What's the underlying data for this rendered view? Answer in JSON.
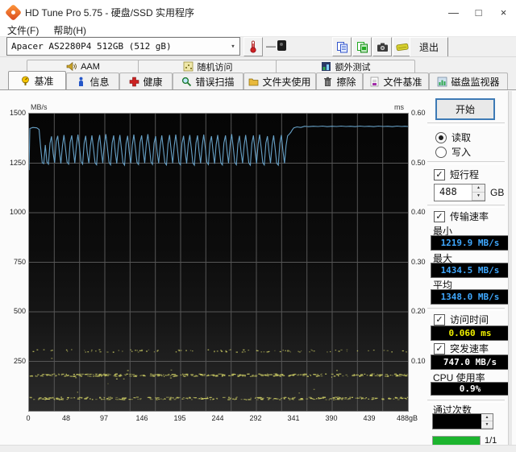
{
  "window": {
    "title": "HD Tune Pro 5.75 - 硬盘/SSD 实用程序",
    "controls": {
      "minimize": "—",
      "maximize": "□",
      "close": "×"
    }
  },
  "menu": {
    "file": "文件(F)",
    "help": "帮助(H)"
  },
  "toolbar": {
    "drive_select": "Apacer AS2280P4 512GB (512 gB)",
    "combo_arrow": "▾",
    "temp_value": "—",
    "exit_label": "退出"
  },
  "tabs": {
    "row1": [
      {
        "label": "AAM"
      },
      {
        "label": "随机访问"
      },
      {
        "label": "额外测试"
      }
    ],
    "row2": [
      {
        "label": "基准"
      },
      {
        "label": "信息"
      },
      {
        "label": "健康"
      },
      {
        "label": "错误扫描"
      },
      {
        "label": "文件夹使用"
      },
      {
        "label": "擦除"
      },
      {
        "label": "文件基准"
      },
      {
        "label": "磁盘监视器"
      }
    ]
  },
  "panel": {
    "start_label": "开始",
    "read_label": "读取",
    "write_label": "写入",
    "short_stroke_label": "短行程",
    "short_stroke_value": "488",
    "short_stroke_unit": "GB",
    "transfer_label": "传输速率",
    "min_label": "最小",
    "min_value": "1219.9 MB/s",
    "max_label": "最大",
    "max_value": "1434.5 MB/s",
    "avg_label": "平均",
    "avg_value": "1348.0 MB/s",
    "access_label": "访问时间",
    "access_value": "0.060 ms",
    "burst_label": "突发速率",
    "burst_value": "747.0 MB/s",
    "cpu_label": "CPU 使用率",
    "cpu_value": "0.9%",
    "pass_label": "通过次数",
    "pass_count_value": "",
    "pass_progress": "1/1",
    "check_glyph": "✓"
  },
  "colors": {
    "line_blue": "#67a1c7",
    "scatter_yellow": "#c9c963",
    "value_blue": "#3fa8ff",
    "value_yellow": "#f0f000",
    "value_white": "#ffffff",
    "progress_green": "#1cb42e",
    "grid_gray": "#565656"
  },
  "chart_data": {
    "type": "line",
    "title": "HD Tune benchmark transfer rate with access time scatter",
    "x": {
      "min": 0,
      "max": 488,
      "unit": "gB",
      "tick_labels": [
        "0",
        "48",
        "97",
        "146",
        "195",
        "244",
        "292",
        "341",
        "390",
        "439",
        "488gB"
      ]
    },
    "y_left": {
      "unit": "MB/s",
      "min": 0,
      "max": 1500,
      "ticks": [
        1500,
        1250,
        1000,
        750,
        500,
        250
      ]
    },
    "y_right": {
      "unit": "ms",
      "min": 0,
      "max": 0.6,
      "ticks": [
        "0.60",
        "0.50",
        "0.40",
        "0.30",
        "0.20",
        "0.10"
      ]
    },
    "grid": {
      "v_cells": 15,
      "h_step": 250
    },
    "series": [
      {
        "name": "transfer-rate",
        "unit": "MB/s",
        "points": [
          [
            0,
            1215
          ],
          [
            1,
            1425
          ],
          [
            5,
            1430
          ],
          [
            10,
            1428
          ],
          [
            13,
            1420
          ],
          [
            15,
            1330
          ],
          [
            17,
            1252
          ],
          [
            19,
            1248
          ],
          [
            21,
            1342
          ],
          [
            23,
            1256
          ],
          [
            25,
            1245
          ],
          [
            27,
            1350
          ],
          [
            29,
            1385
          ],
          [
            31,
            1300
          ],
          [
            33,
            1252
          ],
          [
            35,
            1360
          ],
          [
            37,
            1388
          ],
          [
            39,
            1310
          ],
          [
            41,
            1248
          ],
          [
            43,
            1335
          ],
          [
            45,
            1392
          ],
          [
            47,
            1322
          ],
          [
            49,
            1255
          ],
          [
            51,
            1245
          ],
          [
            53,
            1355
          ],
          [
            55,
            1390
          ],
          [
            57,
            1316
          ],
          [
            59,
            1250
          ],
          [
            61,
            1340
          ],
          [
            63,
            1394
          ],
          [
            65,
            1330
          ],
          [
            67,
            1258
          ],
          [
            69,
            1245
          ],
          [
            71,
            1352
          ],
          [
            73,
            1388
          ],
          [
            75,
            1305
          ],
          [
            77,
            1250
          ],
          [
            79,
            1338
          ],
          [
            81,
            1390
          ],
          [
            83,
            1325
          ],
          [
            85,
            1252
          ],
          [
            87,
            1242
          ],
          [
            89,
            1350
          ],
          [
            91,
            1392
          ],
          [
            93,
            1312
          ],
          [
            95,
            1250
          ],
          [
            97,
            1345
          ],
          [
            99,
            1396
          ],
          [
            101,
            1326
          ],
          [
            103,
            1254
          ],
          [
            105,
            1242
          ],
          [
            107,
            1352
          ],
          [
            109,
            1390
          ],
          [
            111,
            1308
          ],
          [
            113,
            1248
          ],
          [
            115,
            1340
          ],
          [
            117,
            1392
          ],
          [
            119,
            1322
          ],
          [
            121,
            1252
          ],
          [
            123,
            1240
          ],
          [
            125,
            1350
          ],
          [
            127,
            1388
          ],
          [
            129,
            1310
          ],
          [
            131,
            1249
          ],
          [
            133,
            1342
          ],
          [
            135,
            1394
          ],
          [
            137,
            1328
          ],
          [
            139,
            1254
          ],
          [
            141,
            1243
          ],
          [
            143,
            1354
          ],
          [
            145,
            1390
          ],
          [
            147,
            1312
          ],
          [
            149,
            1250
          ],
          [
            151,
            1344
          ],
          [
            153,
            1396
          ],
          [
            155,
            1330
          ],
          [
            157,
            1256
          ],
          [
            159,
            1244
          ],
          [
            161,
            1352
          ],
          [
            163,
            1386
          ],
          [
            165,
            1306
          ],
          [
            167,
            1250
          ],
          [
            169,
            1340
          ],
          [
            171,
            1390
          ],
          [
            173,
            1320
          ],
          [
            175,
            1252
          ],
          [
            177,
            1241
          ],
          [
            179,
            1348
          ],
          [
            181,
            1392
          ],
          [
            183,
            1314
          ],
          [
            185,
            1249
          ],
          [
            187,
            1338
          ],
          [
            189,
            1394
          ],
          [
            191,
            1326
          ],
          [
            193,
            1253
          ],
          [
            195,
            1242
          ],
          [
            197,
            1350
          ],
          [
            199,
            1388
          ],
          [
            201,
            1308
          ],
          [
            203,
            1248
          ],
          [
            205,
            1342
          ],
          [
            207,
            1392
          ],
          [
            209,
            1324
          ],
          [
            211,
            1251
          ],
          [
            213,
            1240
          ],
          [
            215,
            1352
          ],
          [
            217,
            1390
          ],
          [
            219,
            1310
          ],
          [
            221,
            1249
          ],
          [
            223,
            1340
          ],
          [
            225,
            1394
          ],
          [
            227,
            1328
          ],
          [
            229,
            1255
          ],
          [
            231,
            1243
          ],
          [
            233,
            1350
          ],
          [
            235,
            1386
          ],
          [
            237,
            1306
          ],
          [
            239,
            1247
          ],
          [
            241,
            1344
          ],
          [
            243,
            1392
          ],
          [
            245,
            1322
          ],
          [
            247,
            1252
          ],
          [
            249,
            1241
          ],
          [
            251,
            1352
          ],
          [
            253,
            1390
          ],
          [
            255,
            1312
          ],
          [
            257,
            1250
          ],
          [
            259,
            1342
          ],
          [
            261,
            1396
          ],
          [
            263,
            1330
          ],
          [
            265,
            1254
          ],
          [
            267,
            1242
          ],
          [
            269,
            1348
          ],
          [
            271,
            1388
          ],
          [
            273,
            1308
          ],
          [
            275,
            1249
          ],
          [
            277,
            1340
          ],
          [
            279,
            1392
          ],
          [
            281,
            1324
          ],
          [
            283,
            1251
          ],
          [
            285,
            1240
          ],
          [
            287,
            1350
          ],
          [
            289,
            1390
          ],
          [
            291,
            1314
          ],
          [
            293,
            1248
          ],
          [
            295,
            1344
          ],
          [
            297,
            1394
          ],
          [
            299,
            1326
          ],
          [
            301,
            1253
          ],
          [
            303,
            1241
          ],
          [
            305,
            1352
          ],
          [
            307,
            1386
          ],
          [
            309,
            1310
          ],
          [
            311,
            1250
          ],
          [
            313,
            1342
          ],
          [
            315,
            1390
          ],
          [
            317,
            1322
          ],
          [
            319,
            1250
          ],
          [
            321,
            1240
          ],
          [
            323,
            1350
          ],
          [
            325,
            1392
          ],
          [
            327,
            1312
          ],
          [
            329,
            1249
          ],
          [
            331,
            1338
          ],
          [
            333,
            1388
          ],
          [
            335,
            1395
          ],
          [
            337,
            1405
          ],
          [
            339,
            1418
          ],
          [
            341,
            1428
          ],
          [
            345,
            1433
          ],
          [
            350,
            1430
          ],
          [
            355,
            1436
          ],
          [
            360,
            1434
          ],
          [
            366,
            1436
          ],
          [
            372,
            1435
          ],
          [
            378,
            1437
          ],
          [
            384,
            1434
          ],
          [
            390,
            1436
          ],
          [
            396,
            1435
          ],
          [
            402,
            1437
          ],
          [
            408,
            1435
          ],
          [
            414,
            1436
          ],
          [
            420,
            1434
          ],
          [
            426,
            1437
          ],
          [
            432,
            1435
          ],
          [
            438,
            1436
          ],
          [
            444,
            1434
          ],
          [
            450,
            1437
          ],
          [
            456,
            1435
          ],
          [
            462,
            1436
          ],
          [
            468,
            1434
          ],
          [
            474,
            1437
          ],
          [
            480,
            1435
          ],
          [
            484,
            1436
          ],
          [
            488,
            1435
          ]
        ]
      }
    ],
    "scatter_bands": [
      {
        "name": "access-time-band-high",
        "ms": 0.122,
        "count": 95,
        "dash": false
      },
      {
        "name": "access-time-band-mid",
        "ms": 0.073,
        "count": 360,
        "dash": true
      },
      {
        "name": "access-time-band-low",
        "ms": 0.026,
        "count": 290,
        "dash": true
      },
      {
        "name": "access-time-strays",
        "ms_range": [
          0.03,
          0.115
        ],
        "count": 14
      }
    ],
    "scatter_seed": 42
  }
}
